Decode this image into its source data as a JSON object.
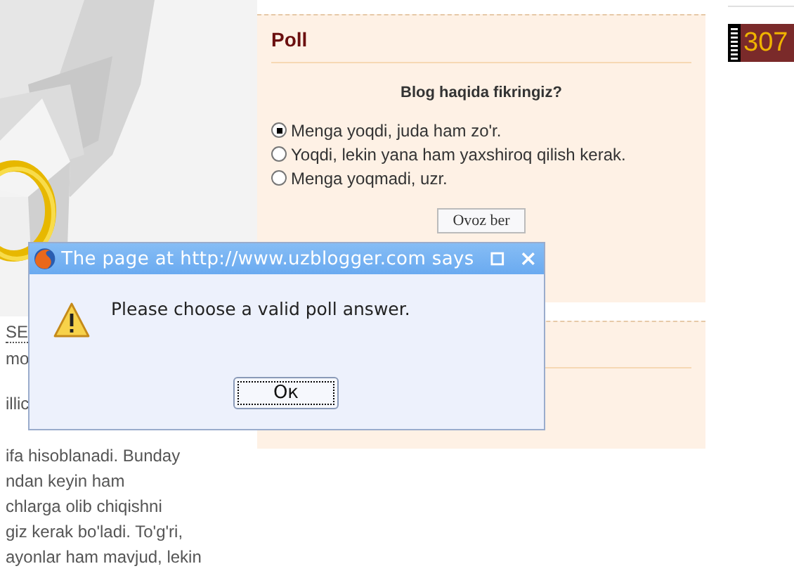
{
  "left_column": {
    "link": "SE",
    "lines": [
      "mo",
      "illic",
      "ifa hisoblanadi. Bunday",
      "ndan keyin ham",
      "chlarga olib chiqishni",
      "giz kerak bo'ladi. To'g'ri,",
      "ayonlar ham mavjud, lekin"
    ]
  },
  "poll": {
    "title": "Poll",
    "question": "Blog haqida fikringiz?",
    "options": [
      {
        "label": "Menga yoqdi, juda ham zo'r.",
        "selected": true
      },
      {
        "label": "Yoqdi, lekin yana ham yaxshiroq qilish kerak.",
        "selected": false
      },
      {
        "label": "Menga yoqmadi, uzr.",
        "selected": false
      }
    ],
    "button": "Ovoz ber"
  },
  "counter": {
    "value": "307"
  },
  "dialog": {
    "title": "The page at http://www.uzblogger.com says",
    "message": "Please choose a valid poll answer.",
    "button": "Oк"
  }
}
